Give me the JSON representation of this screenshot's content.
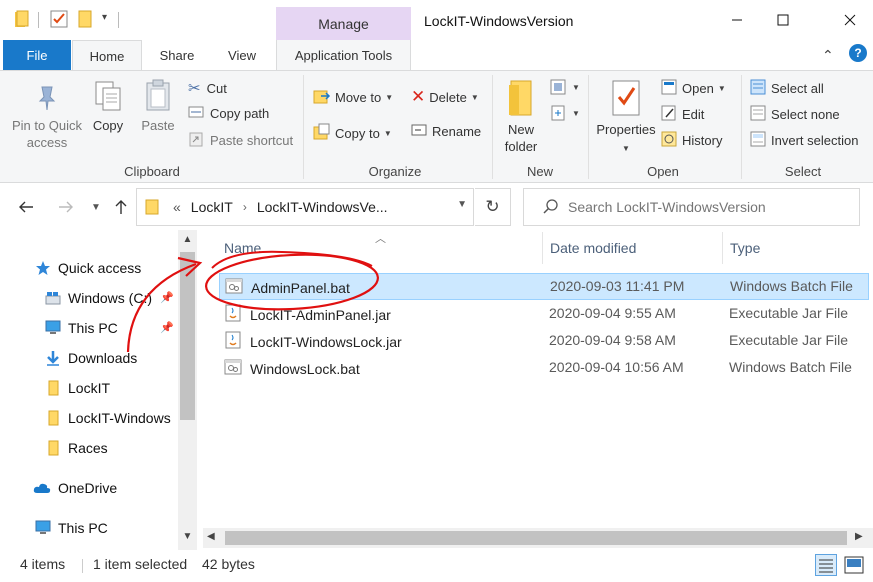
{
  "window": {
    "title": "LockIT-WindowsVersion",
    "contextual_group": "Manage"
  },
  "tabs": {
    "file": "File",
    "home": "Home",
    "share": "Share",
    "view": "View",
    "app_tools": "Application Tools",
    "help": "?"
  },
  "ribbon": {
    "clipboard": {
      "group": "Clipboard",
      "pin": "Pin to Quick\naccess",
      "copy": "Copy",
      "paste": "Paste",
      "cut": "Cut",
      "copy_path": "Copy path",
      "paste_shortcut": "Paste shortcut"
    },
    "organize": {
      "group": "Organize",
      "move_to": "Move to",
      "copy_to": "Copy to",
      "delete": "Delete",
      "rename": "Rename"
    },
    "new": {
      "group": "New",
      "new_folder": "New\nfolder"
    },
    "open": {
      "group": "Open",
      "properties": "Properties",
      "open": "Open",
      "edit": "Edit",
      "history": "History"
    },
    "select": {
      "group": "Select",
      "select_all": "Select all",
      "select_none": "Select none",
      "invert": "Invert selection"
    }
  },
  "address": {
    "prefix": "«",
    "crumbs": [
      "LockIT",
      "LockIT-WindowsVe..."
    ],
    "search_placeholder": "Search LockIT-WindowsVersion"
  },
  "nav": {
    "items": [
      {
        "label": "Quick access",
        "icon": "star-icon"
      },
      {
        "label": "Windows (C:)",
        "icon": "drive-icon",
        "pinned": true
      },
      {
        "label": "This PC",
        "icon": "computer-icon",
        "pinned": true
      },
      {
        "label": "Downloads",
        "icon": "download-icon"
      },
      {
        "label": "LockIT",
        "icon": "folder-icon"
      },
      {
        "label": "LockIT-Windows",
        "icon": "folder-icon"
      },
      {
        "label": "Races",
        "icon": "folder-icon"
      },
      {
        "label": "OneDrive",
        "icon": "cloud-icon"
      },
      {
        "label": "This PC",
        "icon": "computer-icon"
      }
    ]
  },
  "files": {
    "columns": [
      "Name",
      "Date modified",
      "Type"
    ],
    "rows": [
      {
        "name": "AdminPanel.bat",
        "date": "2020-09-03 11:41 PM",
        "type": "Windows Batch File",
        "icon": "batch-file-icon",
        "selected": true
      },
      {
        "name": "LockIT-AdminPanel.jar",
        "date": "2020-09-04 9:55 AM",
        "type": "Executable Jar File",
        "icon": "jar-file-icon",
        "selected": false
      },
      {
        "name": "LockIT-WindowsLock.jar",
        "date": "2020-09-04 9:58 AM",
        "type": "Executable Jar File",
        "icon": "jar-file-icon",
        "selected": false
      },
      {
        "name": "WindowsLock.bat",
        "date": "2020-09-04 10:56 AM",
        "type": "Windows Batch File",
        "icon": "batch-file-icon",
        "selected": false
      }
    ]
  },
  "status": {
    "count": "4 items",
    "selected": "1 item selected",
    "size": "42 bytes"
  },
  "colors": {
    "accent": "#1979ca",
    "manage_tab": "#e6d6f3",
    "selection": "#cce8ff",
    "annotation": "#e01010"
  }
}
